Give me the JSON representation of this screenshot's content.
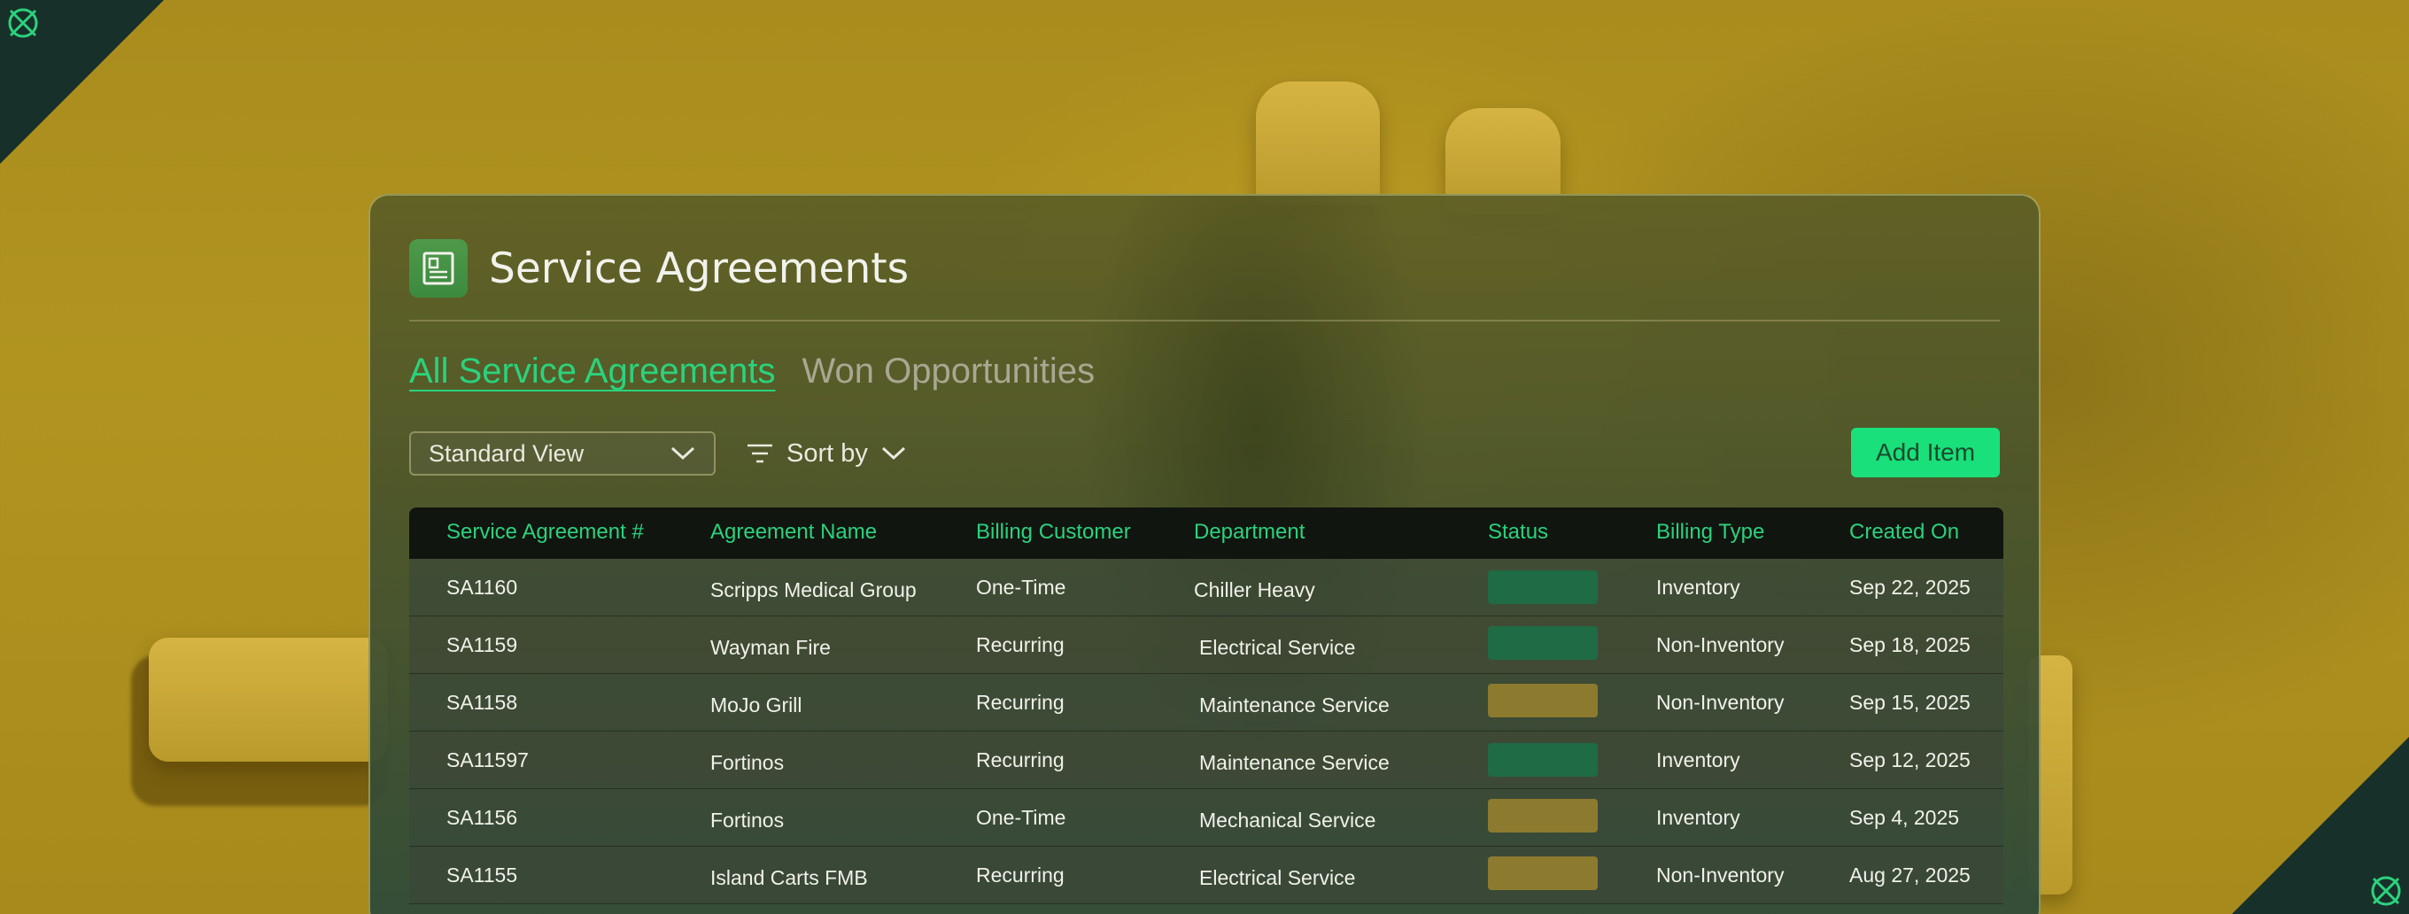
{
  "page": {
    "title": "Service Agreements"
  },
  "tabs": [
    {
      "label": "All Service Agreements",
      "active": true
    },
    {
      "label": "Won Opportunities",
      "active": false
    }
  ],
  "toolbar": {
    "view_select_value": "Standard View",
    "sort_label": "Sort by",
    "add_button_label": "Add Item"
  },
  "table": {
    "columns": [
      "Service Agreement #",
      "Agreement Name",
      "Billing Customer",
      "Department",
      "Status",
      "Billing Type",
      "Created On"
    ],
    "rows": [
      {
        "id": "SA1160",
        "name": "Scripps Medical Group",
        "billing_customer": "One-Time",
        "department": "Chiller Heavy",
        "status_color": "#1f6b45",
        "billing_type": "Inventory",
        "created_on": "Sep 22, 2025"
      },
      {
        "id": "SA1159",
        "name": "Wayman Fire",
        "billing_customer": "Recurring",
        "department": "Electrical Service",
        "status_color": "#1f6b45",
        "billing_type": "Non-Inventory",
        "created_on": "Sep 18, 2025"
      },
      {
        "id": "SA1158",
        "name": "MoJo Grill",
        "billing_customer": "Recurring",
        "department": "Maintenance Service",
        "status_color": "#8c7a2e",
        "billing_type": "Non-Inventory",
        "created_on": "Sep 15, 2025"
      },
      {
        "id": "SA11597",
        "name": "Fortinos",
        "billing_customer": "Recurring",
        "department": "Maintenance Service",
        "status_color": "#1f6b45",
        "billing_type": "Inventory",
        "created_on": "Sep 12, 2025"
      },
      {
        "id": "SA1156",
        "name": "Fortinos",
        "billing_customer": "One-Time",
        "department": "Mechanical Service",
        "status_color": "#8c7a2e",
        "billing_type": "Inventory",
        "created_on": "Sep 4, 2025"
      },
      {
        "id": "SA1155",
        "name": "Island Carts FMB",
        "billing_customer": "Recurring",
        "department": "Electrical Service",
        "status_color": "#8c7a2e",
        "billing_type": "Non-Inventory",
        "created_on": "Aug 27, 2025"
      }
    ]
  },
  "icons": {
    "header": "document-icon",
    "view_select": "chevron-down-icon",
    "sort": "filter-lines-icon",
    "corner_logo": "crosshair-logo-icon"
  },
  "colors": {
    "accent": "#2bd27d",
    "button": "#19e07a",
    "status_active": "#1f6b45",
    "status_pending": "#8c7a2e"
  }
}
